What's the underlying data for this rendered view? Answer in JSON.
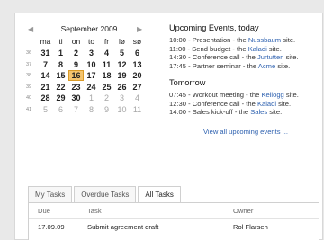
{
  "calendar": {
    "prev_icon": "◀",
    "next_icon": "▶",
    "month_label": "September 2009",
    "weekdays": [
      "ma",
      "ti",
      "on",
      "to",
      "fr",
      "lø",
      "sø"
    ],
    "weeks": [
      {
        "wk": "36",
        "days": [
          "31",
          "1",
          "2",
          "3",
          "4",
          "5",
          "6"
        ]
      },
      {
        "wk": "37",
        "days": [
          "7",
          "8",
          "9",
          "10",
          "11",
          "12",
          "13"
        ]
      },
      {
        "wk": "38",
        "days": [
          "14",
          "15",
          "16",
          "17",
          "18",
          "19",
          "20"
        ]
      },
      {
        "wk": "39",
        "days": [
          "21",
          "22",
          "23",
          "24",
          "25",
          "26",
          "27"
        ]
      },
      {
        "wk": "40",
        "days": [
          "28",
          "29",
          "30",
          "1",
          "2",
          "3",
          "4"
        ]
      },
      {
        "wk": "41",
        "days": [
          "5",
          "6",
          "7",
          "8",
          "9",
          "10",
          "11"
        ]
      }
    ]
  },
  "events": {
    "today_heading": "Upcoming Events, today",
    "today": [
      {
        "text": "10:00 - Presentation - the ",
        "site": "Nussbaum",
        "suffix": " site."
      },
      {
        "text": "11:00 - Send budget - the ",
        "site": "Kaladi",
        "suffix": " site."
      },
      {
        "text": "14:30 - Conference call - the ",
        "site": "Jurtutten",
        "suffix": " site."
      },
      {
        "text": "17:45 - Partner seminar - the ",
        "site": "Acme",
        "suffix": " site."
      }
    ],
    "tomorrow_heading": "Tomorrow",
    "tomorrow": [
      {
        "text": "07:45 - Workout meeting - the ",
        "site": "Kellogg",
        "suffix": " site."
      },
      {
        "text": "12:30 - Conference call - the ",
        "site": "Kaladi",
        "suffix": " site."
      },
      {
        "text": "14:00 - Sales kick-off - the ",
        "site": "Sales",
        "suffix": " site."
      }
    ],
    "view_all": "View all upcoming events ..."
  },
  "tasks": {
    "tabs": [
      {
        "label": "My Tasks",
        "active": false
      },
      {
        "label": "Overdue Tasks",
        "active": false
      },
      {
        "label": "All Tasks",
        "active": true
      }
    ],
    "columns": {
      "due": "Due",
      "task": "Task",
      "owner": "Owner"
    },
    "rows": [
      {
        "due": "17.09.09",
        "task": "Submit agreement draft",
        "owner": "Rol Flarsen"
      }
    ]
  }
}
